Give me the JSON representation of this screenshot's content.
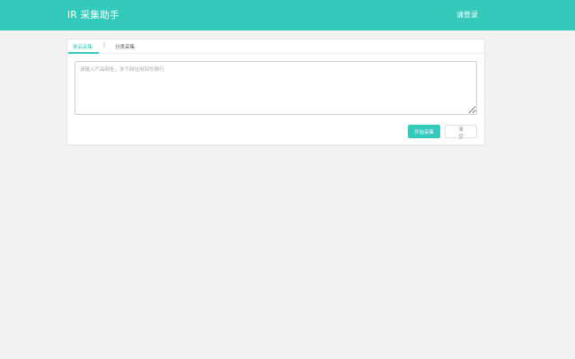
{
  "header": {
    "app_title": "IR 采集助手",
    "login_label": "请登录"
  },
  "tabs": [
    {
      "label": "单品采集",
      "active": true
    },
    {
      "label": "分类采集",
      "active": false
    }
  ],
  "tab_separator": "|",
  "url_input": {
    "value": "",
    "placeholder": "请输入产品网址，多个网址用回车换行"
  },
  "actions": {
    "start_label": "开始采集",
    "clear_label": "清空"
  },
  "colors": {
    "accent": "#33c9bb",
    "background": "#f2f2f2",
    "panel": "#ffffff"
  }
}
